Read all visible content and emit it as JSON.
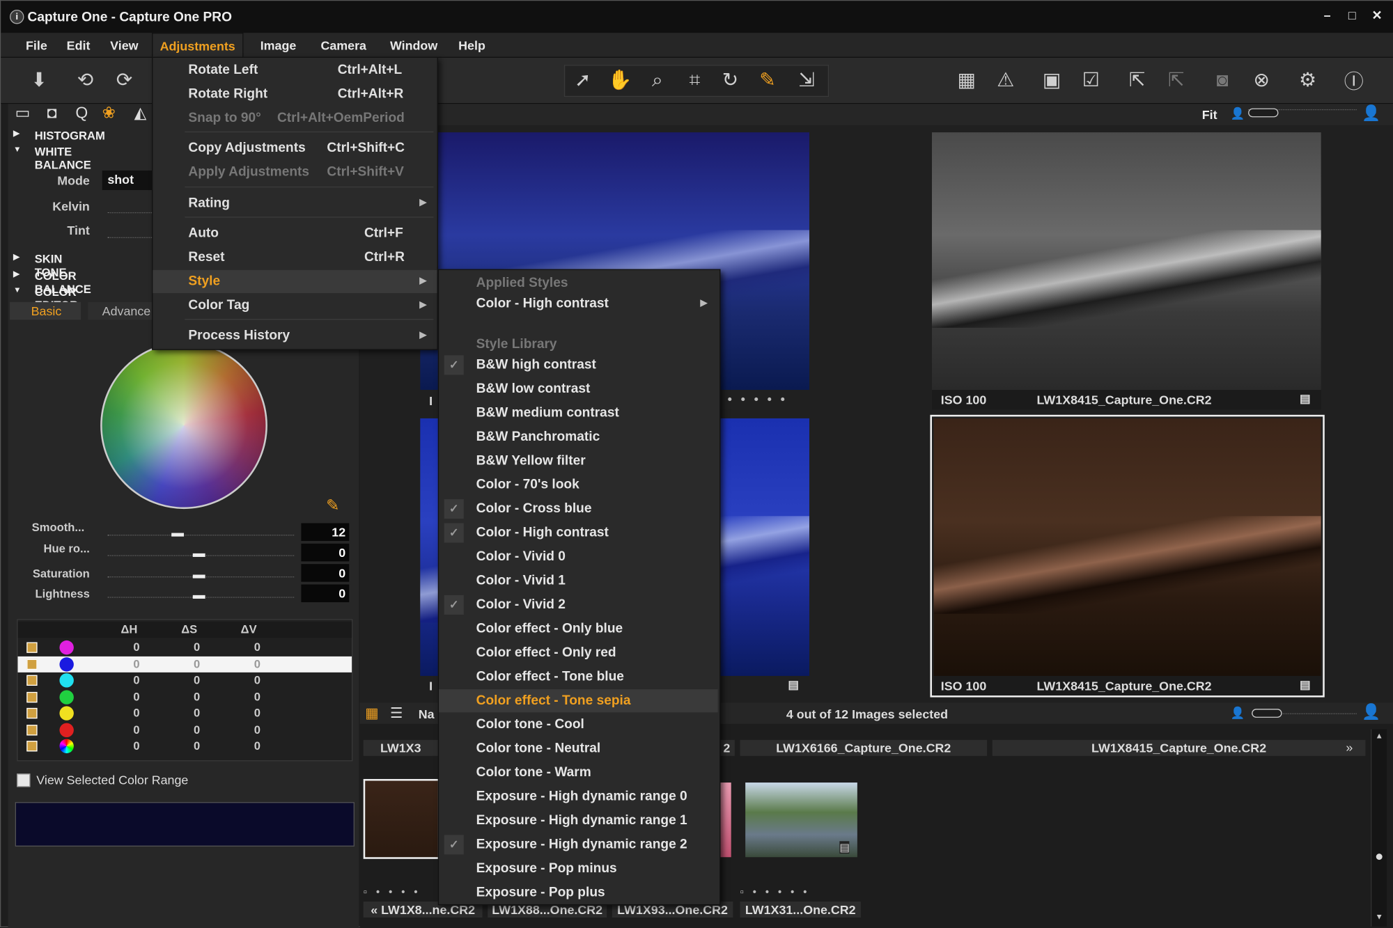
{
  "window": {
    "title": "Capture One - Capture One PRO",
    "minimize": "–",
    "maximize": "□",
    "close": "✕"
  },
  "menubar": [
    "File",
    "Edit",
    "View",
    "Adjustments",
    "Image",
    "Camera",
    "Window",
    "Help"
  ],
  "adjustments_menu": {
    "items": [
      {
        "label": "Rotate Left",
        "shortcut": "Ctrl+Alt+L",
        "disabled": false
      },
      {
        "label": "Rotate Right",
        "shortcut": "Ctrl+Alt+R",
        "disabled": false
      },
      {
        "label": "Snap to 90°",
        "shortcut": "Ctrl+Alt+OemPeriod",
        "disabled": true
      },
      {
        "label": "Copy Adjustments",
        "shortcut": "Ctrl+Shift+C",
        "disabled": false
      },
      {
        "label": "Apply Adjustments",
        "shortcut": "Ctrl+Shift+V",
        "disabled": true
      },
      {
        "label": "Rating",
        "shortcut": "",
        "disabled": false
      },
      {
        "label": "Auto",
        "shortcut": "Ctrl+F",
        "disabled": false
      },
      {
        "label": "Reset",
        "shortcut": "Ctrl+R",
        "disabled": false
      },
      {
        "label": "Style",
        "shortcut": "",
        "disabled": false
      },
      {
        "label": "Color Tag",
        "shortcut": "",
        "disabled": false
      },
      {
        "label": "Process History",
        "shortcut": "",
        "disabled": false
      }
    ]
  },
  "style_menu": {
    "applied_header": "Applied Styles",
    "applied_item": "Color - High contrast",
    "library_header": "Style Library",
    "items": [
      {
        "label": "B&W high contrast",
        "checked": true
      },
      {
        "label": "B&W low contrast",
        "checked": false
      },
      {
        "label": "B&W medium contrast",
        "checked": false
      },
      {
        "label": "B&W Panchromatic",
        "checked": false
      },
      {
        "label": "B&W Yellow filter",
        "checked": false
      },
      {
        "label": "Color - 70's look",
        "checked": false
      },
      {
        "label": "Color - Cross blue",
        "checked": true
      },
      {
        "label": "Color - High contrast",
        "checked": true
      },
      {
        "label": "Color - Vivid 0",
        "checked": false
      },
      {
        "label": "Color - Vivid 1",
        "checked": false
      },
      {
        "label": "Color - Vivid 2",
        "checked": true
      },
      {
        "label": "Color effect - Only blue",
        "checked": false
      },
      {
        "label": "Color effect - Only red",
        "checked": false
      },
      {
        "label": "Color effect - Tone blue",
        "checked": false
      },
      {
        "label": "Color effect - Tone sepia",
        "checked": false,
        "highlighted": true
      },
      {
        "label": "Color tone - Cool",
        "checked": false
      },
      {
        "label": "Color tone - Neutral",
        "checked": false
      },
      {
        "label": "Color tone - Warm",
        "checked": false
      },
      {
        "label": "Exposure - High dynamic range 0",
        "checked": false
      },
      {
        "label": "Exposure - High dynamic range 1",
        "checked": false
      },
      {
        "label": "Exposure - High dynamic range 2",
        "checked": true
      },
      {
        "label": "Exposure - Pop minus",
        "checked": false
      },
      {
        "label": "Exposure - Pop plus",
        "checked": false
      }
    ]
  },
  "left_panel": {
    "sections": {
      "histogram": "HISTOGRAM",
      "white_balance": "WHITE BALANCE",
      "skin_tone": "SKIN TONE",
      "color_balance": "COLOR BALANCE",
      "color_editor": "COLOR EDITOR"
    },
    "wb": {
      "mode_label": "Mode",
      "mode_value": "shot",
      "kelvin_label": "Kelvin",
      "tint_label": "Tint"
    },
    "tabs": {
      "basic": "Basic",
      "advanced": "Advance"
    },
    "sliders": [
      {
        "label": "Smooth...",
        "value": "12"
      },
      {
        "label": "Hue ro...",
        "value": "0"
      },
      {
        "label": "Saturation",
        "value": "0"
      },
      {
        "label": "Lightness",
        "value": "0"
      }
    ],
    "table": {
      "headers": [
        "ΔH",
        "ΔS",
        "ΔV"
      ],
      "rows": [
        {
          "color": "#e020e0",
          "h": "0",
          "s": "0",
          "v": "0"
        },
        {
          "color": "#1a1ae0",
          "h": "0",
          "s": "0",
          "v": "0",
          "selected": true
        },
        {
          "color": "#20e0f0",
          "h": "0",
          "s": "0",
          "v": "0"
        },
        {
          "color": "#20d040",
          "h": "0",
          "s": "0",
          "v": "0"
        },
        {
          "color": "#f0e020",
          "h": "0",
          "s": "0",
          "v": "0"
        },
        {
          "color": "#e02020",
          "h": "0",
          "s": "0",
          "v": "0"
        },
        {
          "color": "rainbow",
          "h": "0",
          "s": "0",
          "v": "0"
        }
      ]
    },
    "view_range": "View Selected Color Range"
  },
  "viewer": {
    "fit_label": "Fit",
    "captions": [
      {
        "iso": "ISO 100",
        "name": "LW1X8415_Capture_One.CR2"
      },
      {
        "iso": "ISO 100",
        "name": "LW1X8415_Capture_One.CR2"
      }
    ],
    "partial_iso": "I"
  },
  "browser": {
    "status": "4 out of 12 Images selected",
    "name_col": "Na",
    "top_names": [
      "LW1X3",
      "2",
      "LW1X6166_Capture_One.CR2",
      "LW1X8415_Capture_One.CR2"
    ],
    "bottom_names": [
      "LW1X8...ne.CR2",
      "LW1X88...One.CR2",
      "LW1X93...One.CR2",
      "LW1X31...One.CR2"
    ]
  },
  "colors": {
    "accent": "#f0a020",
    "selected_text": "#f0a020"
  }
}
